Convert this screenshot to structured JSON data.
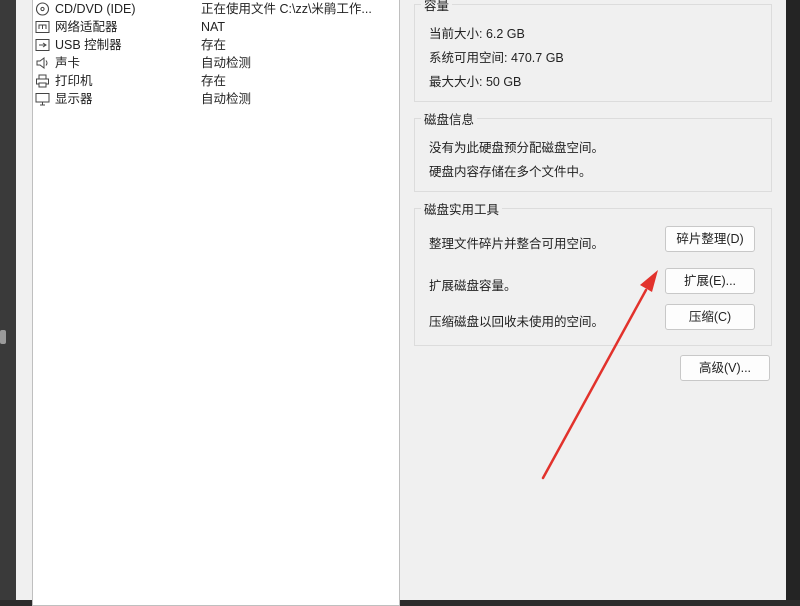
{
  "devices": [
    {
      "name": "CD/DVD (IDE)",
      "summary": "正在使用文件 C:\\zz\\米鹃工作...",
      "icon": "cd-icon"
    },
    {
      "name": "网络适配器",
      "summary": "NAT",
      "icon": "network-icon"
    },
    {
      "name": "USB 控制器",
      "summary": "存在",
      "icon": "usb-icon"
    },
    {
      "name": "声卡",
      "summary": "自动检测",
      "icon": "speaker-icon"
    },
    {
      "name": "打印机",
      "summary": "存在",
      "icon": "printer-icon"
    },
    {
      "name": "显示器",
      "summary": "自动检测",
      "icon": "monitor-icon"
    }
  ],
  "capacity": {
    "title": "容量",
    "current_size": "当前大小: 6.2 GB",
    "free_space": "系统可用空间: 470.7 GB",
    "max_size": "最大大小: 50 GB"
  },
  "disk_info": {
    "title": "磁盘信息",
    "line1": "没有为此硬盘预分配磁盘空间。",
    "line2": "硬盘内容存储在多个文件中。"
  },
  "disk_utilities": {
    "title": "磁盘实用工具",
    "defrag_desc": "整理文件碎片并整合可用空间。",
    "defrag_button": "碎片整理(D)",
    "expand_desc": "扩展磁盘容量。",
    "expand_button": "扩展(E)...",
    "compact_desc": "压缩磁盘以回收未使用的空间。",
    "compact_button": "压缩(C)"
  },
  "advanced_button": "高级(V)...",
  "colors": {
    "arrow": "#e2322c",
    "dialog_bg": "#f0f0f0",
    "list_bg": "#ffffff"
  }
}
